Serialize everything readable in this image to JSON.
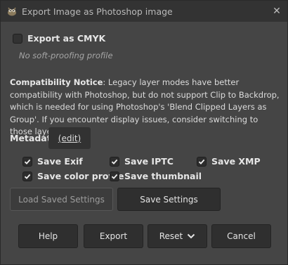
{
  "window": {
    "title": "Export Image as Photoshop image",
    "close_glyph": "✕"
  },
  "options": {
    "export_cmyk_label": "Export as CMYK",
    "export_cmyk_checked": false,
    "soft_proof_text": "No soft-proofing profile"
  },
  "notice": {
    "heading": "Compatibility Notice",
    "body": ": Legacy layer modes have better compatibility with Photoshop, but do not support Clip to Backdrop, which is needed for using Photoshop's 'Blend Clipped Layers as Group'. If you encounter display issues, consider switching to those layer modes."
  },
  "metadata": {
    "label": "Metadata",
    "edit_label": "(edit)",
    "items": [
      {
        "label": "Save Exif",
        "checked": true
      },
      {
        "label": "Save IPTC",
        "checked": true
      },
      {
        "label": "Save XMP",
        "checked": true
      },
      {
        "label": "Save color profile",
        "checked": true
      },
      {
        "label": "Save thumbnail",
        "checked": true
      }
    ]
  },
  "settings_buttons": {
    "load": "Load Saved Settings",
    "save": "Save Settings"
  },
  "footer": {
    "help": "Help",
    "export": "Export",
    "reset": "Reset",
    "cancel": "Cancel"
  },
  "colors": {
    "background": "#454545",
    "titlebar": "#333333",
    "button": "#2f2f2f"
  }
}
